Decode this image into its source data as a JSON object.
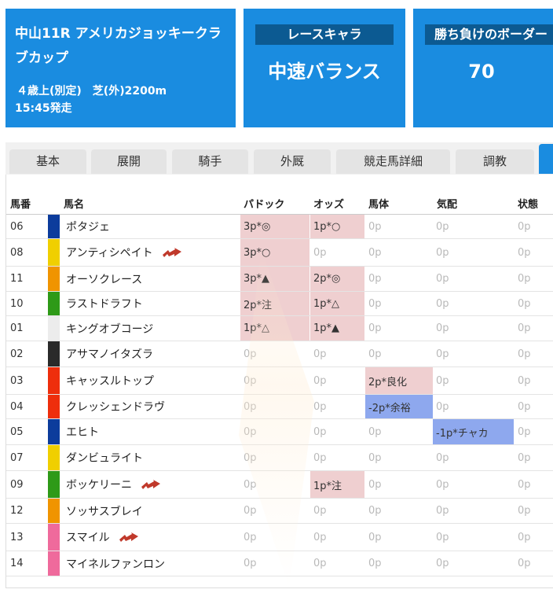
{
  "race": {
    "title": "中山11R アメリカジョッキークラブカップ",
    "conditions": "４歳上(別定)　芝(外)2200m",
    "start_time": "15:45発走"
  },
  "race_chara": {
    "label": "レースキャラ",
    "value": "中速バランス"
  },
  "border": {
    "label": "勝ち負けのボーダー",
    "value": "70"
  },
  "tabs": [
    "基本",
    "展開",
    "騎手",
    "外厩",
    "競走馬詳細",
    "調教"
  ],
  "table": {
    "headers": [
      "馬番",
      "馬名",
      "パドック",
      "オッズ",
      "馬体",
      "気配",
      "状態"
    ],
    "rows": [
      {
        "num": "06",
        "color": "#0c3c9c",
        "name": "ポタジェ",
        "arrow": false,
        "paddock": "3p*◎",
        "odds": "1p*○",
        "body": "0p",
        "spirit": "0p",
        "state": "0p"
      },
      {
        "num": "08",
        "color": "#f0cf00",
        "name": "アンティシペイト",
        "arrow": true,
        "paddock": "3p*○",
        "odds": "0p",
        "body": "0p",
        "spirit": "0p",
        "state": "0p"
      },
      {
        "num": "11",
        "color": "#f09400",
        "name": "オーソクレース",
        "arrow": false,
        "paddock": "3p*▲",
        "odds": "2p*◎",
        "body": "0p",
        "spirit": "0p",
        "state": "0p"
      },
      {
        "num": "10",
        "color": "#2e9a18",
        "name": "ラストドラフト",
        "arrow": false,
        "paddock": "2p*注",
        "odds": "1p*△",
        "body": "0p",
        "spirit": "0p",
        "state": "0p"
      },
      {
        "num": "01",
        "color": "#ececec",
        "name": "キングオブコージ",
        "arrow": false,
        "paddock": "1p*△",
        "odds": "1p*▲",
        "body": "0p",
        "spirit": "0p",
        "state": "0p"
      },
      {
        "num": "02",
        "color": "#2a2a2a",
        "name": "アサマノイタズラ",
        "arrow": false,
        "paddock": "0p",
        "odds": "0p",
        "body": "0p",
        "spirit": "0p",
        "state": "0p"
      },
      {
        "num": "03",
        "color": "#ee2e0c",
        "name": "キャッスルトップ",
        "arrow": false,
        "paddock": "0p",
        "odds": "0p",
        "body": "2p*良化",
        "spirit": "0p",
        "state": "0p"
      },
      {
        "num": "04",
        "color": "#ee2e0c",
        "name": "クレッシェンドラヴ",
        "arrow": false,
        "paddock": "0p",
        "odds": "0p",
        "body": "-2p*余裕",
        "spirit": "0p",
        "state": "0p"
      },
      {
        "num": "05",
        "color": "#0c3c9c",
        "name": "エヒト",
        "arrow": false,
        "paddock": "0p",
        "odds": "0p",
        "body": "0p",
        "spirit": "-1p*チャカ",
        "state": "0p"
      },
      {
        "num": "07",
        "color": "#f0cf00",
        "name": "ダンビュライト",
        "arrow": false,
        "paddock": "0p",
        "odds": "0p",
        "body": "0p",
        "spirit": "0p",
        "state": "0p"
      },
      {
        "num": "09",
        "color": "#2e9a18",
        "name": "ボッケリーニ",
        "arrow": true,
        "paddock": "0p",
        "odds": "1p*注",
        "body": "0p",
        "spirit": "0p",
        "state": "0p"
      },
      {
        "num": "12",
        "color": "#f09400",
        "name": "ソッサスブレイ",
        "arrow": false,
        "paddock": "0p",
        "odds": "0p",
        "body": "0p",
        "spirit": "0p",
        "state": "0p"
      },
      {
        "num": "13",
        "color": "#ef6a9c",
        "name": "スマイル",
        "arrow": true,
        "paddock": "0p",
        "odds": "0p",
        "body": "0p",
        "spirit": "0p",
        "state": "0p"
      },
      {
        "num": "14",
        "color": "#ef6a9c",
        "name": "マイネルファンロン",
        "arrow": false,
        "paddock": "0p",
        "odds": "0p",
        "body": "0p",
        "spirit": "0p",
        "state": "0p"
      }
    ]
  },
  "icons": {
    "trend": "red-arrow-icon"
  },
  "colors": {
    "accent": "#1a8ce0",
    "label_bg": "#0c5a92",
    "positive": "#efcfd0",
    "negative": "#8ea8ee"
  }
}
